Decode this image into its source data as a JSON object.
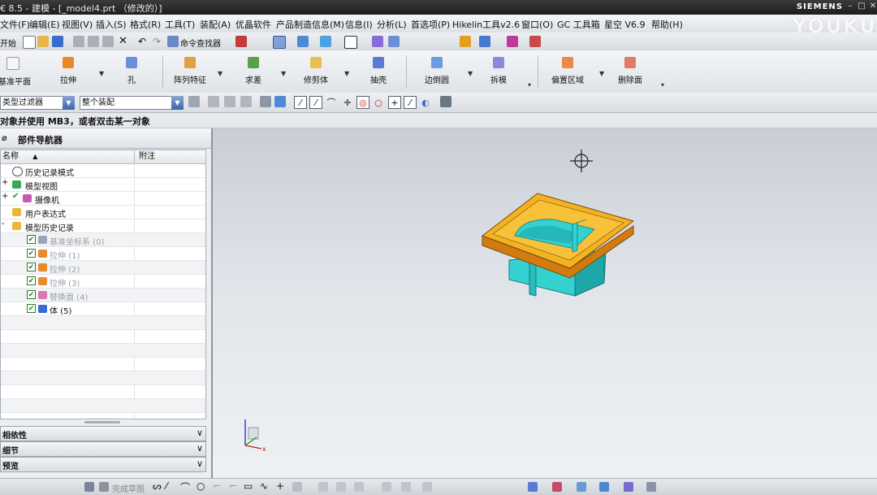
{
  "window": {
    "title": "€ 8.5 - 建模 - [_model4.prt （修改的）]",
    "brand": "SIEMENS",
    "watermark": "YOUKU"
  },
  "menu": [
    "文件(F)",
    "编辑(E)",
    "视图(V)",
    "插入(S)",
    "格式(R)",
    "工具(T)",
    "装配(A)",
    "优晶软件",
    "产品制造信息(M)",
    "信息(I)",
    "分析(L)",
    "首选项(P)",
    "Hikelin工具v2.6",
    "窗口(O)",
    "GC 工具箱",
    "星空 V6.9",
    "帮助(H)"
  ],
  "standard_toolbar": {
    "start_label": "开始",
    "command_finder": "命令查找器"
  },
  "feature_toolbar": [
    "基准平面",
    "拉伸",
    "孔",
    "阵列特征",
    "求差",
    "抽壳",
    "边倒圆",
    "拆模",
    "偏置区域",
    "删除面"
  ],
  "feature_toolbar_extra": "修剪体",
  "selection_bar": {
    "filter": "类型过滤器",
    "scope": "整个装配"
  },
  "cue_line": "对象并使用 MB3，或者双击某一对象",
  "navigator": {
    "title": "部件导航器",
    "columns": [
      "名称",
      "附注"
    ],
    "rows": [
      {
        "label": "历史记录模式",
        "level": 0,
        "expander": "",
        "icon": "clock",
        "checked": false,
        "dim": false
      },
      {
        "label": "模型视图",
        "level": 0,
        "expander": "+",
        "icon": "views",
        "checked": false,
        "dim": false
      },
      {
        "label": "摄像机",
        "level": 0,
        "expander": "+",
        "icon": "camera",
        "checked": true,
        "dim": false
      },
      {
        "label": "用户表达式",
        "level": 0,
        "expander": "",
        "icon": "folder",
        "checked": false,
        "dim": false
      },
      {
        "label": "模型历史记录",
        "level": 0,
        "expander": "-",
        "icon": "folder",
        "checked": false,
        "dim": false
      },
      {
        "label": "基准坐标系 (0)",
        "level": 1,
        "expander": "",
        "icon": "csys",
        "checked": true,
        "dim": true
      },
      {
        "label": "拉伸 (1)",
        "level": 1,
        "expander": "",
        "icon": "extrude",
        "checked": true,
        "dim": true
      },
      {
        "label": "拉伸 (2)",
        "level": 1,
        "expander": "",
        "icon": "extrude",
        "checked": true,
        "dim": true
      },
      {
        "label": "拉伸 (3)",
        "level": 1,
        "expander": "",
        "icon": "extrude",
        "checked": true,
        "dim": true
      },
      {
        "label": "替换面 (4)",
        "level": 1,
        "expander": "",
        "icon": "replace",
        "checked": true,
        "dim": true
      },
      {
        "label": "体 (5)",
        "level": 1,
        "expander": "",
        "icon": "body",
        "checked": true,
        "dim": false
      }
    ],
    "panels": [
      "相依性",
      "细节",
      "预览"
    ]
  },
  "bottom_toolbar": {
    "label": "完成草图"
  },
  "colors": {
    "part_top": "#f2b222",
    "part_edge": "#d27c10",
    "part_body": "#33d2d0",
    "part_shadow": "#1ea7a8",
    "accent": "#3e63a8"
  }
}
